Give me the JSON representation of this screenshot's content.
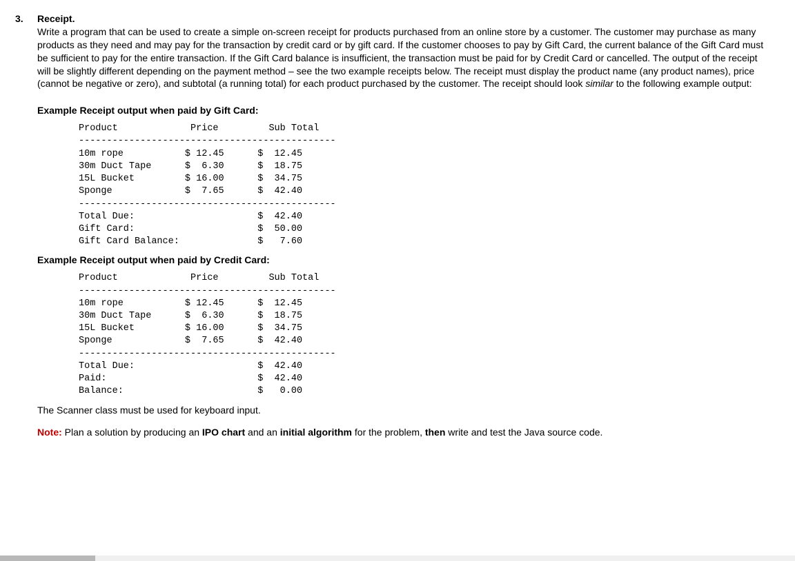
{
  "question": {
    "number": "3.",
    "title": "Receipt.",
    "paragraph": "Write a program that can be used to create a simple on-screen receipt for products purchased from an online store by a customer. The customer may purchase as many products as they need and may pay for the transaction by credit card or by gift card. If the customer chooses to pay by Gift Card, the current balance of the Gift Card must be sufficient to pay for the entire transaction. If the Gift Card balance is insufficient, the transaction must be paid for by Credit Card or cancelled. The output of the receipt will be slightly different depending on the payment method – see the two example receipts below. The receipt must display the product name (any product names), price (cannot be negative or zero), and subtotal (a running total) for each product purchased by the customer. The receipt should look ",
    "similar_word": "similar",
    "paragraph_tail": " to the following example output:"
  },
  "example1": {
    "heading": "Example Receipt output when paid by Gift Card:"
  },
  "example2": {
    "heading": "Example Receipt output when paid by Credit Card:"
  },
  "scanner_note": "The Scanner class must be used for keyboard input.",
  "final_note": {
    "label": "Note:",
    "text_a": " Plan a solution by producing an ",
    "ipo": "IPO chart",
    "text_b": " and an ",
    "algo": "initial algorithm",
    "text_c": " for the problem, ",
    "then": "then",
    "text_d": " write and test the Java source code."
  },
  "chart_data": {
    "type": "table",
    "receipt_headers": [
      "Product",
      "Price",
      "Sub Total"
    ],
    "items": [
      {
        "product": "10m rope",
        "price": 12.45,
        "subtotal": 12.45
      },
      {
        "product": "30m Duct Tape",
        "price": 6.3,
        "subtotal": 18.75
      },
      {
        "product": "15L Bucket",
        "price": 16.0,
        "subtotal": 34.75
      },
      {
        "product": "Sponge",
        "price": 7.65,
        "subtotal": 42.4
      }
    ],
    "gift_card_summary": [
      {
        "label": "Total Due:",
        "value": 42.4
      },
      {
        "label": "Gift Card:",
        "value": 50.0
      },
      {
        "label": "Gift Card Balance:",
        "value": 7.6
      }
    ],
    "credit_card_summary": [
      {
        "label": "Total Due:",
        "value": 42.4
      },
      {
        "label": "Paid:",
        "value": 42.4
      },
      {
        "label": "Balance:",
        "value": 0.0
      }
    ],
    "divider": "----------------------------------------------"
  }
}
